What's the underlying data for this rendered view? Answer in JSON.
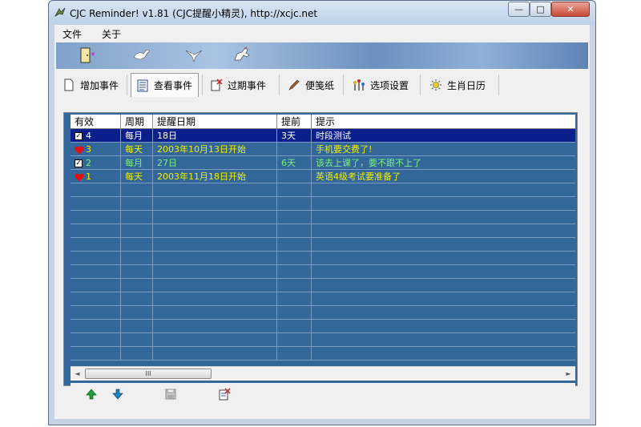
{
  "window": {
    "title": "CJC Reminder! v1.81 (CJC提醒小精灵),  http://xcjc.net"
  },
  "titlebar_buttons": {
    "minimize": "—",
    "maximize": "□",
    "close": "✕"
  },
  "menu": {
    "file": "文件",
    "about": "关于"
  },
  "tabs": [
    {
      "label": "增加事件",
      "icon": "page-icon"
    },
    {
      "label": "查看事件",
      "icon": "list-icon"
    },
    {
      "label": "过期事件",
      "icon": "expired-icon"
    },
    {
      "label": "便笺纸",
      "icon": "pen-icon"
    },
    {
      "label": "选项设置",
      "icon": "settings-icon"
    },
    {
      "label": "生肖日历",
      "icon": "sun-icon"
    }
  ],
  "grid": {
    "columns": [
      "有效",
      "周期",
      "提醒日期",
      "提前",
      "提示"
    ],
    "rows": [
      {
        "marker": "check",
        "id": "4",
        "cycle": "每月",
        "date": "18日",
        "advance": "3天",
        "note": "时段测试",
        "color": "#ffffff",
        "selected": true
      },
      {
        "marker": "heart",
        "id": "3",
        "cycle": "每天",
        "date": "2003年10月13日开始",
        "advance": "",
        "note": "手机要交费了!",
        "color": "#f0f000",
        "selected": false
      },
      {
        "marker": "check",
        "id": "2",
        "cycle": "每月",
        "date": "27日",
        "advance": "6天",
        "note": "该去上课了，要不跟不上了",
        "color": "#7cf07c",
        "selected": false
      },
      {
        "marker": "heart",
        "id": "1",
        "cycle": "每天",
        "date": "2003年11月18日开始",
        "advance": "",
        "note": "英语4级考试要准备了",
        "color": "#f0f000",
        "selected": false
      }
    ],
    "empty_row_count": 13
  },
  "scrollbar": {
    "left": "◄",
    "right": "►",
    "grip": "III"
  },
  "colors": {
    "grid_background": "#346799",
    "selected_row": "#0a1f8c"
  }
}
